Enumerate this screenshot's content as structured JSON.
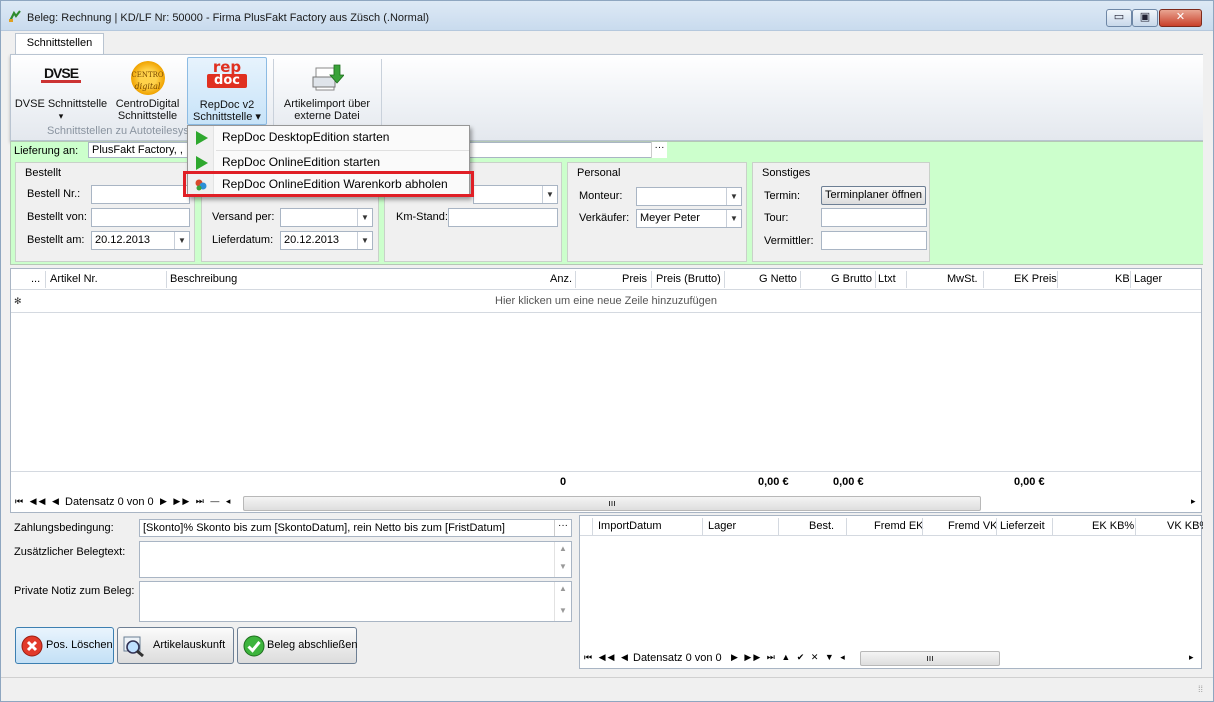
{
  "window": {
    "title": "Beleg: Rechnung  |  KD/LF Nr: 50000 - Firma PlusFakt Factory  aus Züsch (.Normal)",
    "controls": {
      "minimize": "▭",
      "maximize": "▣",
      "close": "✕"
    }
  },
  "ribbon": {
    "tab": "Schnittstellen",
    "group_caption": "Schnittstellen zu Autoteilesys",
    "buttons": {
      "dvse": {
        "line1": "DVSE Schnittstelle",
        "line2": "",
        "arrow": "▾",
        "logo": "DVSE"
      },
      "centro": {
        "line1": "CentroDigital",
        "line2": "Schnittstelle",
        "logo_top": "CENTRO",
        "logo_bottom": "digital"
      },
      "repdoc": {
        "line1": "RepDoc v2",
        "line2": "Schnittstelle ▾",
        "logo_top": "rep",
        "logo_bottom": "doc"
      },
      "artikelimport": {
        "line1": "Artikelimport über",
        "line2": "externe Datei"
      }
    }
  },
  "dropdown_menu": {
    "items": [
      {
        "label": "RepDoc DesktopEdition starten",
        "icon": "play-icon"
      },
      {
        "label": "RepDoc OnlineEdition starten",
        "icon": "play-icon"
      },
      {
        "label": "RepDoc OnlineEdition Warenkorb abholen",
        "icon": "basket-icon"
      }
    ],
    "highlight_color": "#e01f26"
  },
  "header_form": {
    "lieferung_label": "Lieferung an:",
    "lieferung_value": "PlusFakt Factory, ,",
    "ellipsis": "···",
    "bestellt": {
      "title": "Bestellt",
      "nr_label": "Bestell Nr.:",
      "nr_value": "",
      "von_label": "Bestellt von:",
      "von_value": "",
      "am_label": "Bestellt am:",
      "am_value": "20.12.2013"
    },
    "versand": {
      "versand_label": "Versand per:",
      "versand_value": "",
      "lieferdatum_label": "Lieferdatum:",
      "lieferdatum_value": "20.12.2013"
    },
    "fahrzeug": {
      "km_label": "Km-Stand:",
      "km_value": ""
    },
    "personal": {
      "title": "Personal",
      "monteur_label": "Monteur:",
      "monteur_value": "",
      "verkaeufer_label": "Verkäufer:",
      "verkaeufer_value": "Meyer Peter"
    },
    "sonstiges": {
      "title": "Sonstiges",
      "termin_label": "Termin:",
      "termin_button": "Terminplaner öffnen",
      "tour_label": "Tour:",
      "tour_value": "",
      "vermittler_label": "Vermittler:",
      "vermittler_value": ""
    }
  },
  "grid": {
    "columns": [
      "...",
      "Artikel Nr.",
      "Beschreibung",
      "Anz.",
      "Preis",
      "Preis (Brutto)",
      "G Netto",
      "G Brutto",
      "Ltxt",
      "MwSt.",
      "EK Preis",
      "KB",
      "Lager"
    ],
    "new_row_marker": "✻",
    "new_row_text": "Hier klicken um eine neue Zeile hinzuzufügen",
    "totals": {
      "anz": "0",
      "g_netto": "0,00 €",
      "g_brutto": "0,00 €",
      "ek_preis": "0,00 €"
    },
    "nav_text": "Datensatz 0 von 0"
  },
  "lower_form": {
    "zahlung_label": "Zahlungsbedingung:",
    "zahlung_value": "[Skonto]% Skonto bis zum [SkontoDatum], rein Netto bis zum  [FristDatum]",
    "zusatz_label": "Zusätzlicher Belegtext:",
    "notiz_label": "Private Notiz zum Beleg:"
  },
  "buttons": {
    "delete": "Pos. Löschen",
    "info": "Artikelauskunft",
    "finish": "Beleg abschließen"
  },
  "right_grid": {
    "columns": [
      "ImportDatum",
      "Lager",
      "Best.",
      "Fremd EK",
      "Fremd VK",
      "Lieferzeit",
      "EK KB%",
      "VK KB%"
    ],
    "nav_text": "Datensatz 0 von 0"
  }
}
